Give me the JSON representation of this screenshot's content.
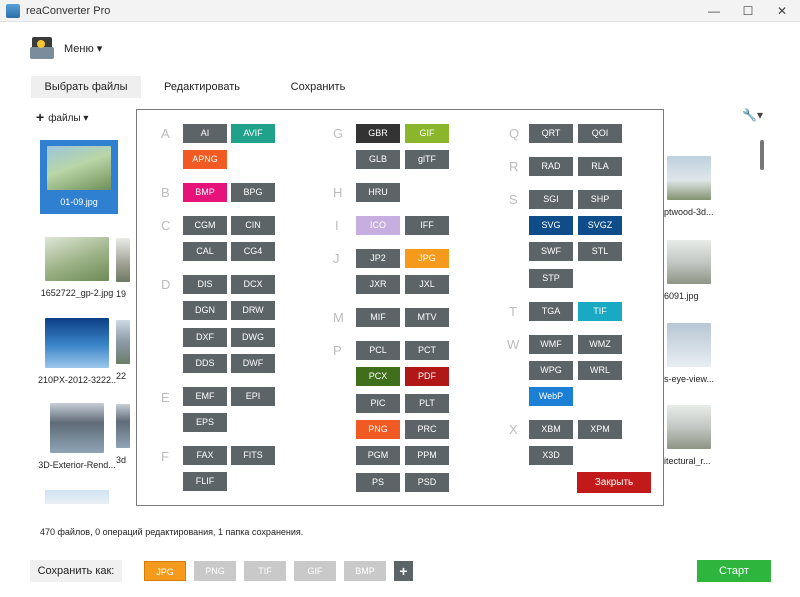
{
  "window": {
    "title": "reaConverter Pro",
    "controls": [
      "—",
      "☐",
      "✕"
    ]
  },
  "menu": {
    "label": "Меню ▾"
  },
  "tabs": [
    {
      "label": "Выбрать файлы",
      "active": true
    },
    {
      "label": "Редактировать",
      "active": false
    },
    {
      "label": "Сохранить",
      "active": false
    }
  ],
  "toolbar": {
    "files_label": "файлы ▾",
    "files_plus": "+",
    "settings_icon": "🔧▾"
  },
  "files": [
    {
      "name": "01-09.jpg",
      "selected": true
    },
    {
      "name": "1652722_gp-2.jpg",
      "selected": false
    },
    {
      "name": "210PX-2012-3222...",
      "selected": false
    },
    {
      "name": "3D-Exterior-Rend...",
      "selected": false
    },
    {
      "name": "",
      "selected": false
    },
    {
      "name": "19",
      "selected": false
    },
    {
      "name": "22",
      "selected": false
    },
    {
      "name": "3d",
      "selected": false
    },
    {
      "name": "ptwood-3d...",
      "selected": false
    },
    {
      "name": "6091.jpg",
      "selected": false
    },
    {
      "name": "s-eye-view...",
      "selected": false
    },
    {
      "name": "itectural_r...",
      "selected": false
    }
  ],
  "popup": {
    "letters": [
      "A",
      "B",
      "C",
      "D",
      "E",
      "F",
      "G",
      "H",
      "I",
      "J",
      "M",
      "P",
      "Q",
      "R",
      "S",
      "T",
      "W",
      "X"
    ],
    "formats": [
      {
        "label": "AI",
        "color": "#5d6468"
      },
      {
        "label": "AVIF",
        "color": "#1fa18a"
      },
      {
        "label": "APNG",
        "color": "#f15a22"
      },
      {
        "label": "BMP",
        "color": "#e6137a"
      },
      {
        "label": "BPG",
        "color": "#5d6468"
      },
      {
        "label": "CGM",
        "color": "#5d6468"
      },
      {
        "label": "CIN",
        "color": "#5d6468"
      },
      {
        "label": "CAL",
        "color": "#5d6468"
      },
      {
        "label": "CG4",
        "color": "#5d6468"
      },
      {
        "label": "DIS",
        "color": "#5d6468"
      },
      {
        "label": "DCX",
        "color": "#5d6468"
      },
      {
        "label": "DGN",
        "color": "#5d6468"
      },
      {
        "label": "DRW",
        "color": "#5d6468"
      },
      {
        "label": "DXF",
        "color": "#5d6468"
      },
      {
        "label": "DWG",
        "color": "#5d6468"
      },
      {
        "label": "DDS",
        "color": "#5d6468"
      },
      {
        "label": "DWF",
        "color": "#5d6468"
      },
      {
        "label": "EMF",
        "color": "#5d6468"
      },
      {
        "label": "EPI",
        "color": "#5d6468"
      },
      {
        "label": "EPS",
        "color": "#5d6468"
      },
      {
        "label": "FAX",
        "color": "#5d6468"
      },
      {
        "label": "FITS",
        "color": "#5d6468"
      },
      {
        "label": "FLIF",
        "color": "#5d6468"
      },
      {
        "label": "GBR",
        "color": "#333333"
      },
      {
        "label": "GIF",
        "color": "#8bb52b"
      },
      {
        "label": "GLB",
        "color": "#5d6468"
      },
      {
        "label": "glTF",
        "color": "#5d6468"
      },
      {
        "label": "HRU",
        "color": "#5d6468"
      },
      {
        "label": "ICO",
        "color": "#c6aee0"
      },
      {
        "label": "IFF",
        "color": "#5d6468"
      },
      {
        "label": "JP2",
        "color": "#5d6468"
      },
      {
        "label": "JPG",
        "color": "#f59a1b"
      },
      {
        "label": "JXR",
        "color": "#5d6468"
      },
      {
        "label": "JXL",
        "color": "#5d6468"
      },
      {
        "label": "MIF",
        "color": "#5d6468"
      },
      {
        "label": "MTV",
        "color": "#5d6468"
      },
      {
        "label": "PCL",
        "color": "#5d6468"
      },
      {
        "label": "PCT",
        "color": "#5d6468"
      },
      {
        "label": "PCX",
        "color": "#3f6f1a"
      },
      {
        "label": "PDF",
        "color": "#b01818"
      },
      {
        "label": "PIC",
        "color": "#5d6468"
      },
      {
        "label": "PLT",
        "color": "#5d6468"
      },
      {
        "label": "PNG",
        "color": "#f15a22"
      },
      {
        "label": "PRC",
        "color": "#5d6468"
      },
      {
        "label": "PGM",
        "color": "#5d6468"
      },
      {
        "label": "PPM",
        "color": "#5d6468"
      },
      {
        "label": "PS",
        "color": "#5d6468"
      },
      {
        "label": "PSD",
        "color": "#5d6468"
      },
      {
        "label": "QRT",
        "color": "#5d6468"
      },
      {
        "label": "QOI",
        "color": "#5d6468"
      },
      {
        "label": "RAD",
        "color": "#5d6468"
      },
      {
        "label": "RLA",
        "color": "#5d6468"
      },
      {
        "label": "SGI",
        "color": "#5d6468"
      },
      {
        "label": "SHP",
        "color": "#5d6468"
      },
      {
        "label": "SVG",
        "color": "#0f4d8a"
      },
      {
        "label": "SVGZ",
        "color": "#0f4d8a"
      },
      {
        "label": "SWF",
        "color": "#5d6468"
      },
      {
        "label": "STL",
        "color": "#5d6468"
      },
      {
        "label": "STP",
        "color": "#5d6468"
      },
      {
        "label": "TGA",
        "color": "#5d6468"
      },
      {
        "label": "TIF",
        "color": "#19a9c2"
      },
      {
        "label": "WMF",
        "color": "#5d6468"
      },
      {
        "label": "WMZ",
        "color": "#5d6468"
      },
      {
        "label": "WPG",
        "color": "#5d6468"
      },
      {
        "label": "WRL",
        "color": "#5d6468"
      },
      {
        "label": "WebP",
        "color": "#1c7fd6"
      },
      {
        "label": "XBM",
        "color": "#5d6468"
      },
      {
        "label": "XPM",
        "color": "#5d6468"
      },
      {
        "label": "X3D",
        "color": "#5d6468"
      }
    ],
    "close_label": "Закрыть"
  },
  "status": {
    "text": "470 файлов, 0 операций редактирования, 1 папка сохранения."
  },
  "bottom": {
    "save_as_label": "Сохранить как:",
    "formats": [
      {
        "label": "JPG",
        "active": true
      },
      {
        "label": "PNG",
        "active": false
      },
      {
        "label": "TIF",
        "active": false
      },
      {
        "label": "GIF",
        "active": false
      },
      {
        "label": "BMP",
        "active": false
      }
    ],
    "add_label": "+",
    "start_label": "Старт"
  }
}
